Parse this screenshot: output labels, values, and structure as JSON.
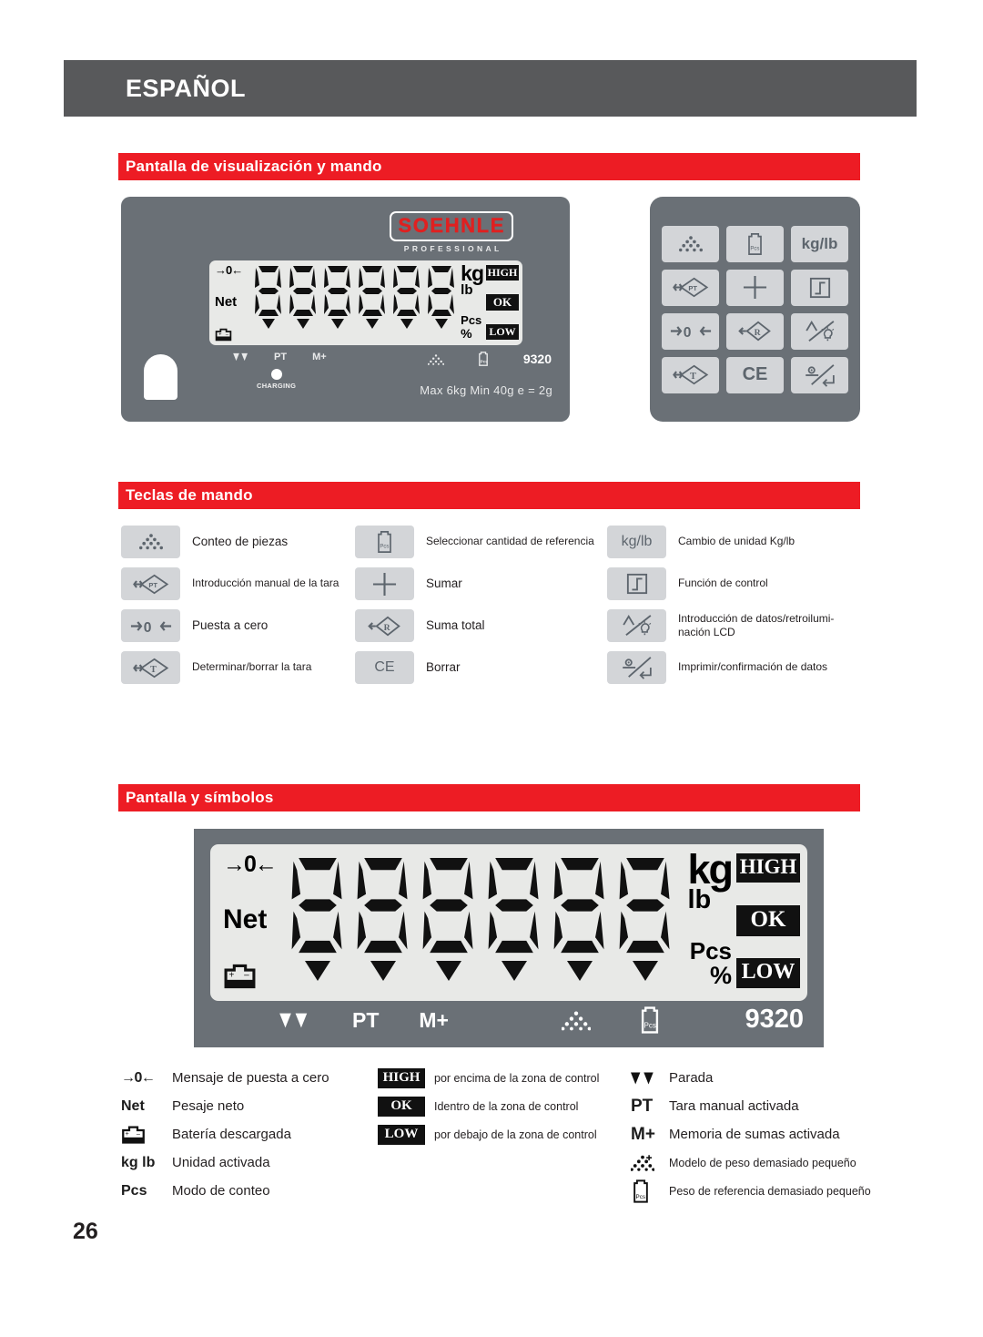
{
  "header": {
    "language": "ESPAÑOL"
  },
  "page_number": "26",
  "sections": {
    "display_control": "Pantalla de visualización y mando",
    "control_keys": "Teclas de mando",
    "display_symbols": "Pantalla y símbolos"
  },
  "colors": {
    "header_grey": "#58595b",
    "section_red": "#ed1c24",
    "device_grey": "#6a7076",
    "key_grey": "#d3d5d8",
    "lcd_glass": "#e8e9e7",
    "logo_red": "#e02020"
  },
  "device": {
    "brand": "SOEHNLE",
    "brand_sub": "PROFESSIONAL",
    "model": "9320",
    "charging_label": "CHARGING",
    "capacity": "Max 6kg  Min 40g  e = 2g",
    "lcd": {
      "zero_symbol": "→0←",
      "net_symbol": "Net",
      "battery_symbol": "battery-icon",
      "digits": "888888",
      "units": {
        "kg": "kg",
        "lb": "lb",
        "pcs": "Pcs",
        "percent": "%"
      },
      "zone_badges": [
        "HIGH",
        "OK",
        "LOW"
      ],
      "bottom_flags": [
        "stable-icon",
        "PT",
        "M+",
        "piece-pattern-icon",
        "reference-weight-icon"
      ]
    }
  },
  "keypad": {
    "keys": [
      {
        "name": "piece-counting-key",
        "icon": "pyramid-dots-icon",
        "label": ""
      },
      {
        "name": "reference-quantity-key",
        "icon": "pcs-box-icon",
        "label": ""
      },
      {
        "name": "unit-switch-key",
        "icon": "",
        "label": "kg/lb"
      },
      {
        "name": "manual-tare-key",
        "icon": "pt-diamond-icon",
        "label": ""
      },
      {
        "name": "add-key",
        "icon": "plus-icon",
        "label": ""
      },
      {
        "name": "control-function-key",
        "icon": "step-box-icon",
        "label": ""
      },
      {
        "name": "zero-key",
        "icon": "arrow-zero-icon",
        "label": ""
      },
      {
        "name": "total-sum-key",
        "icon": "r-diamond-icon",
        "label": ""
      },
      {
        "name": "data-entry-backlight-key",
        "icon": "lamp-slash-icon",
        "label": ""
      },
      {
        "name": "tare-key",
        "icon": "t-diamond-icon",
        "label": ""
      },
      {
        "name": "clear-key",
        "icon": "",
        "label": "CE"
      },
      {
        "name": "print-confirm-key",
        "icon": "print-enter-icon",
        "label": ""
      }
    ]
  },
  "control_keys": {
    "column1": [
      {
        "icon": "pyramid-dots-icon",
        "text": "Conteo de piezas"
      },
      {
        "icon": "pt-diamond-icon",
        "text": "Introducción manual de la tara",
        "small": true
      },
      {
        "icon": "arrow-zero-icon",
        "text": "Puesta a cero"
      },
      {
        "icon": "t-diamond-icon",
        "text": "Determinar/borrar la tara",
        "small": true
      }
    ],
    "column2": [
      {
        "icon": "pcs-box-icon",
        "text": "Seleccionar cantidad de referencia",
        "small": true
      },
      {
        "icon": "plus-icon",
        "text": "Sumar"
      },
      {
        "icon": "r-diamond-icon",
        "text": "Suma total"
      },
      {
        "icon": "ce-text",
        "text": "Borrar"
      }
    ],
    "column3": [
      {
        "icon": "kg-lb-text",
        "text": "Cambio de unidad Kg/lb",
        "small": true
      },
      {
        "icon": "step-box-icon",
        "text": "Función de control",
        "small": true
      },
      {
        "icon": "lamp-slash-icon",
        "text": "Introducción de datos/retroilumi-\nnación LCD",
        "small": true
      },
      {
        "icon": "print-enter-icon",
        "text": "Imprimir/confirmación de datos",
        "small": true
      }
    ]
  },
  "symbols_legend": {
    "column1": [
      {
        "symbol": "→0←",
        "kind": "glyph",
        "text": "Mensaje de puesta a cero"
      },
      {
        "symbol": "Net",
        "kind": "glyph",
        "text": "Pesaje neto"
      },
      {
        "symbol": "battery-icon",
        "kind": "icon",
        "text": "Batería descargada"
      },
      {
        "symbol": "kg lb",
        "kind": "glyph",
        "text": "Unidad activada"
      },
      {
        "symbol": "Pcs",
        "kind": "glyph",
        "text": "Modo de conteo"
      }
    ],
    "column2": [
      {
        "symbol": "HIGH",
        "kind": "badge",
        "text": "por encima de la zona de control"
      },
      {
        "symbol": "OK",
        "kind": "badge",
        "text": "Identro de la zona de control"
      },
      {
        "symbol": "LOW",
        "kind": "badge",
        "text": "por debajo de la zona de control"
      }
    ],
    "column3": [
      {
        "symbol": "stable-icon",
        "kind": "icon",
        "text": "Parada"
      },
      {
        "symbol": "PT",
        "kind": "glyph",
        "text": "Tara manual activada"
      },
      {
        "symbol": "M+",
        "kind": "glyph",
        "text": "Memoria de sumas activada"
      },
      {
        "symbol": "piece-pattern-icon",
        "kind": "icon",
        "text": "Modelo de peso demasiado pequeño",
        "small": true
      },
      {
        "symbol": "reference-weight-icon",
        "kind": "icon",
        "text": "Peso de referencia demasiado pequeño",
        "small": true
      }
    ]
  }
}
